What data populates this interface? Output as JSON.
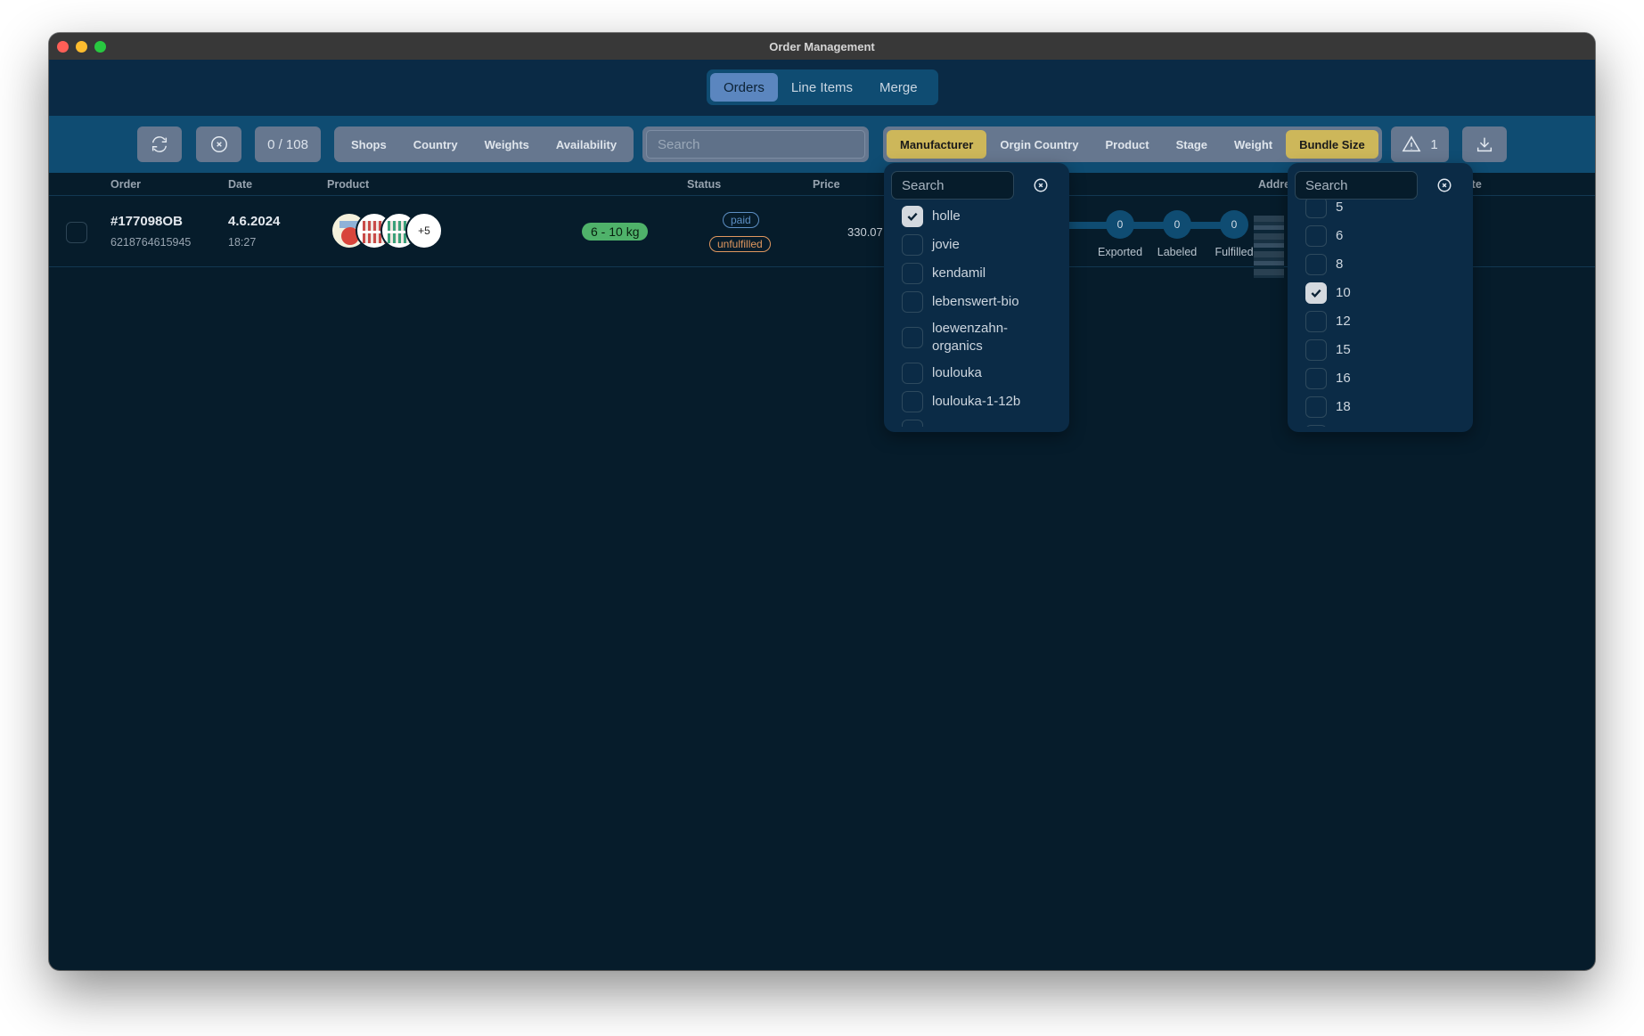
{
  "window": {
    "title": "Order Management"
  },
  "nav": {
    "tabs": [
      {
        "label": "Orders",
        "active": true
      },
      {
        "label": "Line Items",
        "active": false
      },
      {
        "label": "Merge",
        "active": false
      }
    ]
  },
  "toolbar": {
    "refresh_icon": "refresh-icon",
    "clear_icon": "clear-circle-x-icon",
    "count": "0 / 108",
    "filter_group_1": [
      "Shops",
      "Country",
      "Weights",
      "Availability"
    ],
    "search_placeholder": "Search",
    "filter_group_2": [
      {
        "label": "Manufacturer",
        "active": true
      },
      {
        "label": "Orgin Country",
        "active": false
      },
      {
        "label": "Product",
        "active": false
      },
      {
        "label": "Stage",
        "active": false
      },
      {
        "label": "Weight",
        "active": false
      },
      {
        "label": "Bundle Size",
        "active": true
      }
    ],
    "warnings_count": "1",
    "download_icon": "download-icon",
    "accent_color": "#cdb75a"
  },
  "table": {
    "columns": [
      "Order",
      "Date",
      "Product",
      "Status",
      "Price",
      "Address",
      "Note"
    ],
    "rows": [
      {
        "order_id": "#177098OB",
        "order_number": "6218764615945",
        "date": "4.6.2024",
        "time": "18:27",
        "product_more": "+5",
        "weight": "6 - 10 kg",
        "payment_status": "paid",
        "fulfillment_status": "unfulfilled",
        "price": "330.07",
        "pipeline": [
          {
            "label": "Exported",
            "count": "0"
          },
          {
            "label": "Labeled",
            "count": "0"
          },
          {
            "label": "Fulfilled",
            "count": "0"
          }
        ]
      }
    ]
  },
  "manufacturer_dropdown": {
    "search_placeholder": "Search",
    "items": [
      {
        "label": "holle",
        "checked": true
      },
      {
        "label": "jovie",
        "checked": false
      },
      {
        "label": "kendamil",
        "checked": false
      },
      {
        "label": "lebenswert-bio",
        "checked": false
      },
      {
        "label": "loewenzahn-organics",
        "checked": false
      },
      {
        "label": "loulouka",
        "checked": false
      },
      {
        "label": "loulouka-1-12b",
        "checked": false
      }
    ]
  },
  "bundle_size_dropdown": {
    "search_placeholder": "Search",
    "items": [
      {
        "label": "5",
        "checked": false
      },
      {
        "label": "6",
        "checked": false
      },
      {
        "label": "8",
        "checked": false
      },
      {
        "label": "10",
        "checked": true
      },
      {
        "label": "12",
        "checked": false
      },
      {
        "label": "15",
        "checked": false
      },
      {
        "label": "16",
        "checked": false
      },
      {
        "label": "18",
        "checked": false
      }
    ]
  }
}
